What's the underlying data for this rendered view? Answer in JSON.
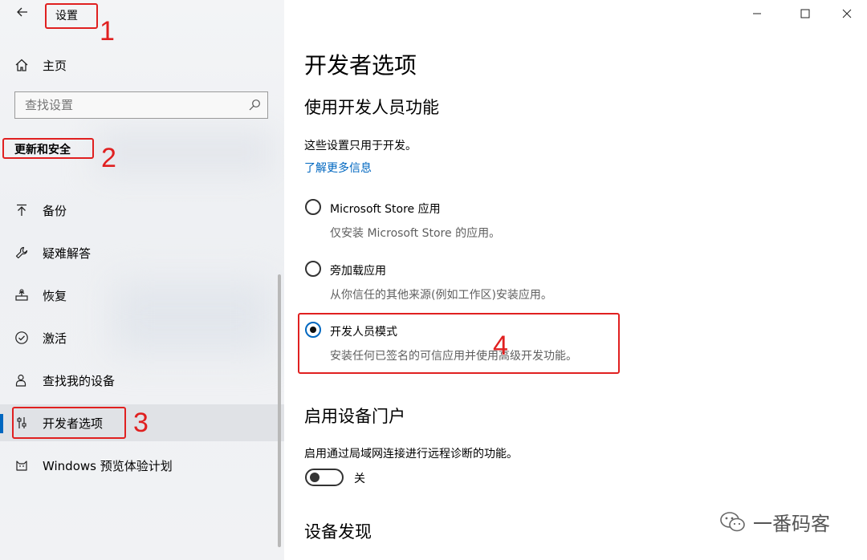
{
  "window": {
    "title": "设置"
  },
  "sidebar": {
    "home_label": "主页",
    "search_placeholder": "查找设置",
    "section_header": "更新和安全",
    "items": [
      {
        "label": "备份",
        "icon": "backup-arrow-icon"
      },
      {
        "label": "疑难解答",
        "icon": "wrench-icon"
      },
      {
        "label": "恢复",
        "icon": "recovery-icon"
      },
      {
        "label": "激活",
        "icon": "check-circle-icon"
      },
      {
        "label": "查找我的设备",
        "icon": "person-location-icon"
      },
      {
        "label": "开发者选项",
        "icon": "developer-sliders-icon",
        "selected": true
      },
      {
        "label": "Windows 预览体验计划",
        "icon": "cat-icon"
      }
    ]
  },
  "annotations": [
    "1",
    "2",
    "3",
    "4"
  ],
  "main": {
    "title": "开发者选项",
    "section1": {
      "heading": "使用开发人员功能",
      "description": "这些设置只用于开发。",
      "link": "了解更多信息",
      "options": [
        {
          "label": "Microsoft Store 应用",
          "desc": "仅安装 Microsoft Store 的应用。",
          "selected": false
        },
        {
          "label": "旁加载应用",
          "desc": "从你信任的其他来源(例如工作区)安装应用。",
          "selected": false
        },
        {
          "label": "开发人员模式",
          "desc": "安装任何已签名的可信应用并使用高级开发功能。",
          "selected": true
        }
      ]
    },
    "section2": {
      "heading": "启用设备门户",
      "description": "启用通过局域网连接进行远程诊断的功能。",
      "toggle_label": "关",
      "toggle_on": false
    },
    "section3": {
      "heading": "设备发现"
    }
  },
  "watermark": {
    "text": "一番码客"
  },
  "colors": {
    "accent": "#0067c0",
    "annotation": "#e02020"
  }
}
